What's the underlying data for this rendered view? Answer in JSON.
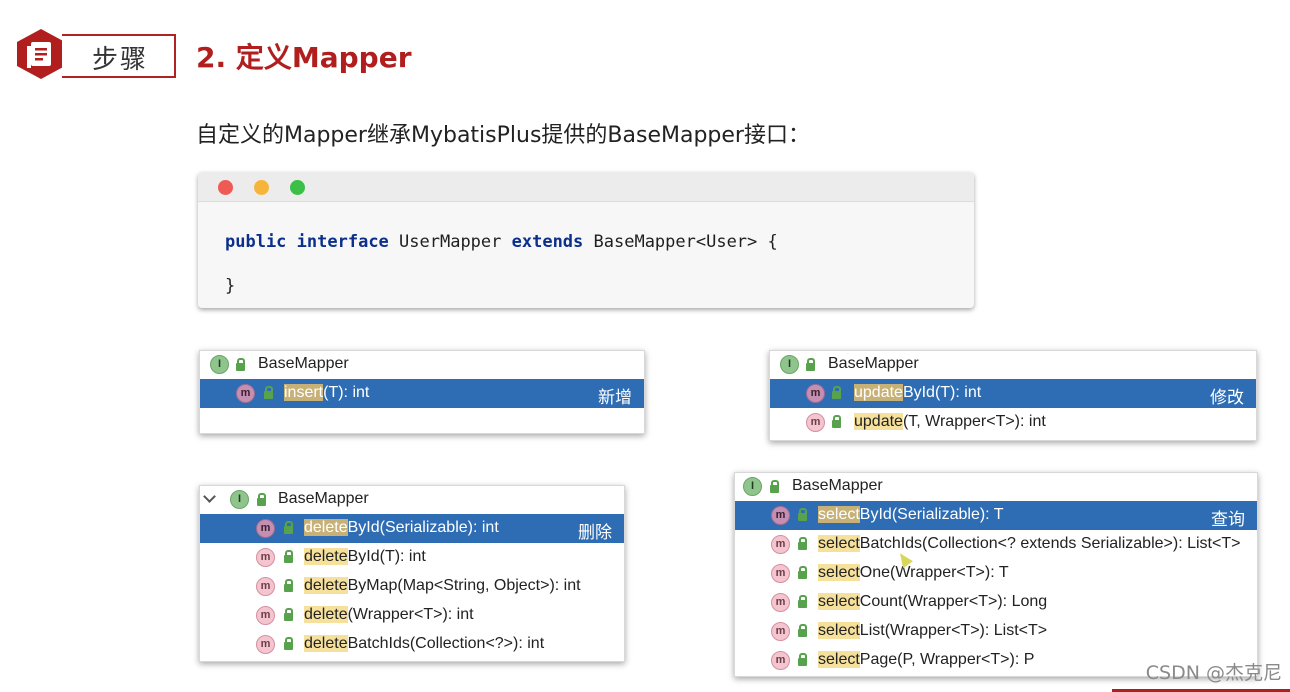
{
  "header": {
    "badge_label": "步骤",
    "step_title": "2.   定义Mapper",
    "subtitle": "自定义的Mapper继承MybatisPlus提供的BaseMapper接口："
  },
  "code_window": {
    "line1": [
      {
        "text": "public",
        "kw": true
      },
      {
        "text": " ",
        "kw": false
      },
      {
        "text": "interface",
        "kw": true
      },
      {
        "text": " UserMapper ",
        "kw": false
      },
      {
        "text": "extends",
        "kw": true
      },
      {
        "text": " BaseMapper<User> {",
        "kw": false
      }
    ],
    "line2": "}"
  },
  "popups": {
    "insert": {
      "header": "BaseMapper",
      "tag": "新增",
      "rows": [
        {
          "hl": "insert",
          "rest": "(T): int",
          "selected": true
        }
      ]
    },
    "update": {
      "header": "BaseMapper",
      "tag": "修改",
      "rows": [
        {
          "hl": "update",
          "rest": "ById(T): int",
          "selected": true
        },
        {
          "hl": "update",
          "rest": "(T, Wrapper<T>): int",
          "selected": false
        }
      ]
    },
    "delete": {
      "header": "BaseMapper",
      "tag": "删除",
      "rows": [
        {
          "hl": "delete",
          "rest": "ById(Serializable): int",
          "selected": true
        },
        {
          "hl": "delete",
          "rest": "ById(T): int",
          "selected": false
        },
        {
          "hl": "delete",
          "rest": "ByMap(Map<String, Object>): int",
          "selected": false
        },
        {
          "hl": "delete",
          "rest": "(Wrapper<T>): int",
          "selected": false
        },
        {
          "hl": "delete",
          "rest": "BatchIds(Collection<?>): int",
          "selected": false
        }
      ]
    },
    "select": {
      "header": "BaseMapper",
      "tag": "查询",
      "rows": [
        {
          "hl": "select",
          "rest": "ById(Serializable): T",
          "selected": true
        },
        {
          "hl": "select",
          "rest": "BatchIds(Collection<? extends Serializable>): List<T>",
          "selected": false
        },
        {
          "hl": "select",
          "rest": "One(Wrapper<T>): T",
          "selected": false
        },
        {
          "hl": "select",
          "rest": "Count(Wrapper<T>): Long",
          "selected": false
        },
        {
          "hl": "select",
          "rest": "List(Wrapper<T>): List<T>",
          "selected": false
        },
        {
          "hl": "select",
          "rest": "Page(P, Wrapper<T>): P",
          "selected": false
        }
      ]
    }
  },
  "icons": {
    "interface_icon": "I",
    "method_icon": "m",
    "lock_icon": "lock-icon"
  },
  "watermark": "CSDN @杰克尼",
  "colors": {
    "accent_red": "#b01e1e",
    "selection_blue": "#2e6db4",
    "match_highlight": "#f6e19c",
    "keyword_blue": "#0b2f8a"
  }
}
